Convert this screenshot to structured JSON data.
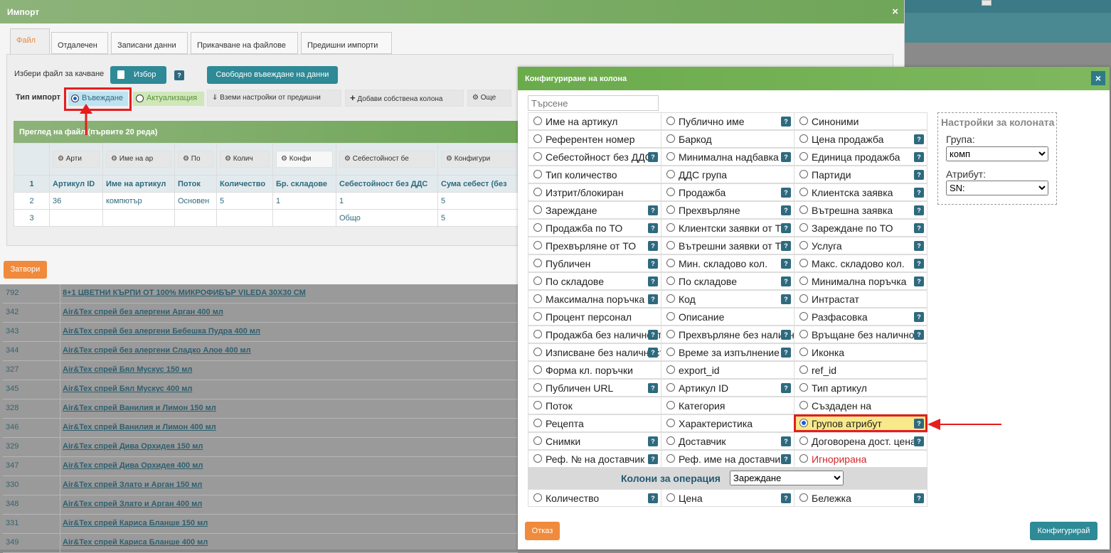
{
  "import_dialog": {
    "title": "Импорт",
    "tabs": [
      "Файл",
      "Отдалечен",
      "Записани данни",
      "Прикачване на файлове",
      "Предишни импорти"
    ],
    "choose_file_label": "Избери файл за качване",
    "choose_button": "Избор",
    "free_entry_button": "Свободно въвеждане на данни",
    "import_type_label": "Тип импорт",
    "import_type_options": [
      "Въвеждане",
      "Актуализация"
    ],
    "import_type_selected": "Въвеждане",
    "take_settings_button": "Вземи настройки от предишни",
    "add_column_button": "Добави собствена колона",
    "more_button": "Още",
    "preview_title": "Преглед на файл (първите 20 реда)",
    "config_buttons": [
      "Арти",
      "Име на ар",
      "По",
      "Колич",
      "Конфи",
      "Себестойност бе",
      "Конфигури"
    ],
    "rows": [
      {
        "num": "1",
        "cells": [
          "Артикул ID",
          "Име на артикул",
          "Поток",
          "Количество",
          "Бр. складове",
          "Себестойност без ДДС",
          "Сума себест (без"
        ]
      },
      {
        "num": "2",
        "cells": [
          "36",
          "компютър",
          "Основен",
          "5",
          "1",
          "1",
          "5"
        ]
      },
      {
        "num": "3",
        "cells": [
          "",
          "",
          "",
          "",
          "",
          "Общо",
          "5"
        ]
      }
    ],
    "close_button": "Затвори"
  },
  "background_list": [
    {
      "id": "792",
      "name": "8+1 ЦВЕТНИ КЪРПИ ОТ 100% МИКРОФИБЪР VILEDA 30X30 СМ"
    },
    {
      "id": "342",
      "name": "Air&Tex спрей без алергени Арган 400 мл"
    },
    {
      "id": "343",
      "name": "Air&Tex спрей без алергени Бебешка Пудра 400 мл"
    },
    {
      "id": "344",
      "name": "Air&Tex спрей без алергени Сладко Алое 400 мл"
    },
    {
      "id": "327",
      "name": "Air&Tex спрей Бял Мускус 150 мл"
    },
    {
      "id": "345",
      "name": "Air&Tex спрей Бял Мускус 400 мл"
    },
    {
      "id": "328",
      "name": "Air&Tex спрей Ванилия и Лимон 150 мл"
    },
    {
      "id": "346",
      "name": "Air&Tex спрей Ванилия и Лимон 400 мл"
    },
    {
      "id": "329",
      "name": "Air&Tex спрей Дива Орхидея 150 мл"
    },
    {
      "id": "347",
      "name": "Air&Tex спрей Дива Орхидея 400 мл"
    },
    {
      "id": "330",
      "name": "Air&Tex спрей Злато и Арган 150 мл"
    },
    {
      "id": "348",
      "name": "Air&Tex спрей Злато и Арган 400 мл"
    },
    {
      "id": "331",
      "name": "Air&Tex спрей Кариса Бланше 150 мл"
    },
    {
      "id": "349",
      "name": "Air&Tex спрей Кариса Бланше 400 мл"
    }
  ],
  "configure_dialog": {
    "title": "Конфигуриране на колона",
    "search_placeholder": "Търсене",
    "columns": [
      [
        {
          "label": "Име на артикул",
          "help": false
        },
        {
          "label": "Референтен номер",
          "help": false
        },
        {
          "label": "Себестойност без ДДС",
          "help": true
        },
        {
          "label": "Тип количество",
          "help": false
        },
        {
          "label": "Изтрит/блокиран",
          "help": false
        },
        {
          "label": "Зареждане",
          "help": true
        },
        {
          "label": "Продажба по ТО",
          "help": true
        },
        {
          "label": "Прехвърляне от ТО",
          "help": true
        },
        {
          "label": "Публичен",
          "help": true
        },
        {
          "label": "По складове",
          "help": true
        },
        {
          "label": "Максимална поръчка",
          "help": true
        },
        {
          "label": "Процент персонал",
          "help": false
        },
        {
          "label": "Продажба без наличност",
          "help": true
        },
        {
          "label": "Изписване без наличност",
          "help": true
        },
        {
          "label": "Форма кл. поръчки",
          "help": false
        },
        {
          "label": "Публичен URL",
          "help": true
        },
        {
          "label": "Поток",
          "help": false
        },
        {
          "label": "Рецепта",
          "help": false
        },
        {
          "label": "Снимки",
          "help": true
        },
        {
          "label": "Реф. № на доставчик",
          "help": true
        }
      ],
      [
        {
          "label": "Публично име",
          "help": true
        },
        {
          "label": "Баркод",
          "help": false
        },
        {
          "label": "Минимална надбавка",
          "help": true
        },
        {
          "label": "ДДС група",
          "help": false
        },
        {
          "label": "Продажба",
          "help": true
        },
        {
          "label": "Прехвърляне",
          "help": true
        },
        {
          "label": "Клиентски заявки от ТО",
          "help": true
        },
        {
          "label": "Вътрешни заявки от ТО",
          "help": true
        },
        {
          "label": "Мин. складово кол.",
          "help": true
        },
        {
          "label": "По складове",
          "help": true
        },
        {
          "label": "Код",
          "help": true
        },
        {
          "label": "Описание",
          "help": false
        },
        {
          "label": "Прехвърляне без наличност",
          "help": true
        },
        {
          "label": "Време за изпълнение",
          "help": true
        },
        {
          "label": "export_id",
          "help": false
        },
        {
          "label": "Артикул ID",
          "help": true
        },
        {
          "label": "Категория",
          "help": false
        },
        {
          "label": "Характеристика",
          "help": false
        },
        {
          "label": "Доставчик",
          "help": true
        },
        {
          "label": "Реф. име на доставчик",
          "help": true
        }
      ],
      [
        {
          "label": "Синоними",
          "help": false
        },
        {
          "label": "Цена продажба",
          "help": true
        },
        {
          "label": "Единица продажба",
          "help": true
        },
        {
          "label": "Партиди",
          "help": true
        },
        {
          "label": "Клиентска заявка",
          "help": true
        },
        {
          "label": "Вътрешна заявка",
          "help": true
        },
        {
          "label": "Зареждане по ТО",
          "help": true
        },
        {
          "label": "Услуга",
          "help": true
        },
        {
          "label": "Макс. складово кол.",
          "help": true
        },
        {
          "label": "Минимална поръчка",
          "help": true
        },
        {
          "label": "Интрастат",
          "help": false
        },
        {
          "label": "Разфасовка",
          "help": true
        },
        {
          "label": "Връщане без наличност",
          "help": true
        },
        {
          "label": "Иконка",
          "help": false
        },
        {
          "label": "ref_id",
          "help": false
        },
        {
          "label": "Тип артикул",
          "help": false
        },
        {
          "label": "Създаден на",
          "help": false
        },
        {
          "label": "Групов атрибут",
          "help": true,
          "selected": true
        },
        {
          "label": "Договорена дост. цена",
          "help": true
        },
        {
          "label": "Игнорирана",
          "help": false,
          "red": true
        }
      ]
    ],
    "operation_label": "Колони за операция",
    "operation_selected": "Зареждане",
    "operation_columns": [
      {
        "label": "Количество",
        "help": true
      },
      {
        "label": "Цена",
        "help": true
      },
      {
        "label": "Бележка",
        "help": true
      }
    ],
    "settings": {
      "title": "Настройки за колоната",
      "group_label": "Група:",
      "group_value": "комп",
      "attribute_label": "Атрибут:",
      "attribute_value": "SN:"
    },
    "cancel_button": "Отказ",
    "configure_button": "Конфигурирай"
  },
  "colors": {
    "accent_green": "#6fa658",
    "teal": "#2e8a97",
    "orange": "#f08a3c",
    "highlight_red": "#e61d1d"
  }
}
